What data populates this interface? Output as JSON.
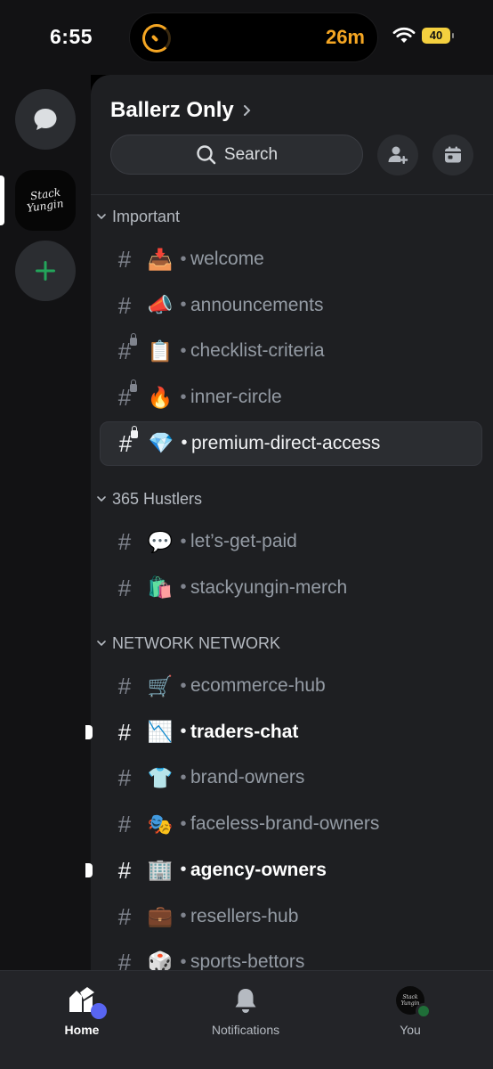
{
  "status_bar": {
    "time": "6:55",
    "activity_text": "26m",
    "battery": "40"
  },
  "server_rail": {
    "server_logo_lines": [
      "Stack",
      "Yungin"
    ]
  },
  "header": {
    "server_name": "Ballerz Only",
    "search_label": "Search"
  },
  "categories": [
    {
      "name": "Important",
      "channels": [
        {
          "emoji": "📥",
          "name": "welcome",
          "locked": false,
          "state": "normal"
        },
        {
          "emoji": "📣",
          "name": "announcements",
          "locked": false,
          "state": "normal"
        },
        {
          "emoji": "📋",
          "name": "checklist-criteria",
          "locked": true,
          "state": "normal"
        },
        {
          "emoji": "🔥",
          "name": "inner-circle",
          "locked": true,
          "state": "normal"
        },
        {
          "emoji": "💎",
          "name": "premium-direct-access",
          "locked": true,
          "state": "selected"
        }
      ]
    },
    {
      "name": "365 Hustlers",
      "channels": [
        {
          "emoji": "💬",
          "name": "let’s-get-paid",
          "locked": false,
          "state": "normal"
        },
        {
          "emoji": "🛍️",
          "name": "stackyungin-merch",
          "locked": false,
          "state": "normal"
        }
      ]
    },
    {
      "name": "NETWORK NETWORK",
      "channels": [
        {
          "emoji": "🛒",
          "name": "ecommerce-hub",
          "locked": false,
          "state": "normal"
        },
        {
          "emoji": "📉",
          "name": "traders-chat",
          "locked": false,
          "state": "unread"
        },
        {
          "emoji": "👕",
          "name": "brand-owners",
          "locked": false,
          "state": "normal"
        },
        {
          "emoji": "🎭",
          "name": "faceless-brand-owners",
          "locked": false,
          "state": "normal"
        },
        {
          "emoji": "🏢",
          "name": "agency-owners",
          "locked": false,
          "state": "unread"
        },
        {
          "emoji": "💼",
          "name": "resellers-hub",
          "locked": false,
          "state": "normal"
        },
        {
          "emoji": "🎲",
          "name": "sports-bettors",
          "locked": false,
          "state": "normal"
        }
      ]
    }
  ],
  "tab_bar": {
    "tabs": [
      {
        "label": "Home",
        "active": true
      },
      {
        "label": "Notifications",
        "active": false
      },
      {
        "label": "You",
        "active": false
      }
    ],
    "you_avatar_lines": [
      "Stack",
      "Yungin"
    ]
  },
  "colors": {
    "accent_blurple": "#5865f2",
    "online_green": "#23a55a",
    "add_green": "#23a55a",
    "activity_orange": "#f5a623",
    "battery_yellow": "#f4d03f"
  }
}
